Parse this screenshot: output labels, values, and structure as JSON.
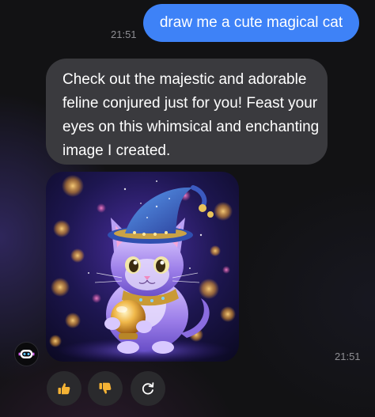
{
  "conversation": {
    "user_message": {
      "text": "draw me a cute magical cat",
      "time": "21:51"
    },
    "bot_message": {
      "text": "Check out the majestic and adorable feline conjured just for you! Feast your eyes on this whimsical and enchanting image I created.",
      "time": "21:51",
      "image_subject": "cute magical cat in wizard hat holding glowing crystal ball"
    }
  },
  "actions": {
    "like_icon": "thumbs-up-icon",
    "dislike_icon": "thumbs-down-icon",
    "regenerate_icon": "refresh-icon"
  },
  "colors": {
    "user_bubble": "#3e82f7",
    "bot_bubble": "#3a3a3e",
    "background": "#121214",
    "timestamp": "#8e8e93",
    "action_button": "#2a2a2d",
    "thumb_color": "#f5b335"
  }
}
